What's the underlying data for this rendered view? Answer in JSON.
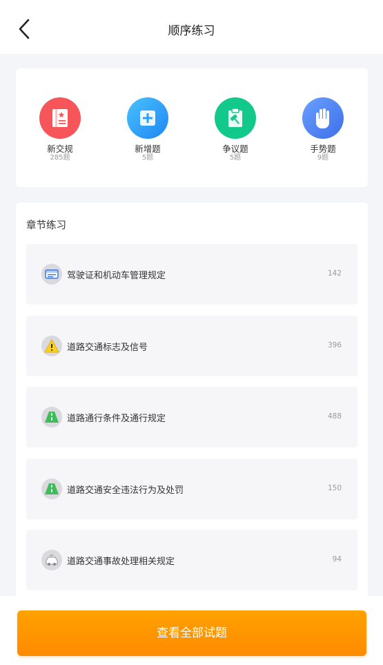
{
  "header": {
    "title": "顺序练习"
  },
  "categories": [
    {
      "name": "新交规",
      "count": "285题",
      "icon": "book-icon",
      "color": "#f6555a"
    },
    {
      "name": "新增题",
      "count": "5题",
      "icon": "plus-icon",
      "color": "#2f9ef5"
    },
    {
      "name": "争议题",
      "count": "5题",
      "icon": "clipboard-hammer-icon",
      "color": "#12c98b"
    },
    {
      "name": "手势题",
      "count": "9题",
      "icon": "hand-icon",
      "color": "#4b7cf2"
    }
  ],
  "chapters": {
    "title": "章节练习",
    "items": [
      {
        "label": "驾驶证和机动车管理规定",
        "count": "142",
        "icon": "license-icon"
      },
      {
        "label": "道路交通标志及信号",
        "count": "396",
        "icon": "warning-icon"
      },
      {
        "label": "道路通行条件及通行规定",
        "count": "488",
        "icon": "road-icon"
      },
      {
        "label": "道路交通安全违法行为及处罚",
        "count": "150",
        "icon": "road-icon"
      },
      {
        "label": "道路交通事故处理相关规定",
        "count": "94",
        "icon": "car-accident-icon"
      }
    ]
  },
  "footer": {
    "button_label": "查看全部试题"
  }
}
